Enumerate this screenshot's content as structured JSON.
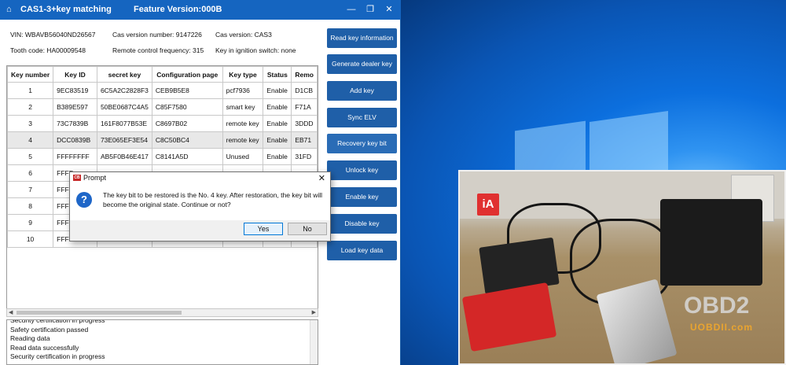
{
  "window": {
    "title": "CAS1-3+key matching",
    "feature_version": "Feature Version:000B"
  },
  "info": {
    "vin": "VIN: WBAVB56040ND26567",
    "cas_version_number": "Cas version number: 9147226",
    "cas_version": "Cas version: CAS3",
    "tooth_code": "Tooth code: HA00009548",
    "remote_control_frequency": "Remote control frequency: 315",
    "key_in_ignition": "Key in ignition switch: none"
  },
  "table": {
    "headers": [
      "Key number",
      "Key ID",
      "secret key",
      "Configuration page",
      "Key type",
      "Status",
      "Remo"
    ],
    "rows": [
      [
        "1",
        "9EC83519",
        "6C5A2C2828F3",
        "CEB9B5E8",
        "pcf7936",
        "Enable",
        "D1CB"
      ],
      [
        "2",
        "B389E597",
        "50BE0687C4A5",
        "C85F7580",
        "smart key",
        "Enable",
        "F71A"
      ],
      [
        "3",
        "73C7839B",
        "161F8077B53E",
        "C8697B02",
        "remote key",
        "Enable",
        "3DDD"
      ],
      [
        "4",
        "DCC0839B",
        "73E065EF3E54",
        "C8C50BC4",
        "remote key",
        "Enable",
        "EB71"
      ],
      [
        "5",
        "FFFFFFFF",
        "AB5F0B46E417",
        "C8141A5D",
        "Unused",
        "Enable",
        "31FD"
      ],
      [
        "6",
        "FFFF",
        "",
        "",
        "",
        "",
        ""
      ],
      [
        "7",
        "FFFF",
        "",
        "",
        "",
        "",
        ""
      ],
      [
        "8",
        "FFFF",
        "",
        "",
        "",
        "",
        ""
      ],
      [
        "9",
        "FFFF",
        "",
        "",
        "",
        "",
        ""
      ],
      [
        "10",
        "FFFF",
        "",
        "",
        "",
        "",
        ""
      ]
    ],
    "selected_row_index": 3
  },
  "log": [
    "Security certification in progress",
    "Safety certification passed",
    "Reading data",
    "Read data successfully",
    "Security certification in progress"
  ],
  "buttons": {
    "read_key_information": "Read key information",
    "generate_dealer_key": "Generate dealer key",
    "add_key": "Add key",
    "sync_elv": "Sync ELV",
    "recovery_key_bit": "Recovery key bit",
    "unlock_key": "Unlock key",
    "enable_key": "Enable key",
    "disable_key": "Disable key",
    "load_key_data": "Load key data"
  },
  "dialog": {
    "title": "Prompt",
    "app_badge": "CB",
    "message": "The key bit to be restored is the No. 4 key. After restoration, the key bit will become the original state. Continue or not?",
    "yes_label": "Yes",
    "no_label": "No"
  },
  "photo": {
    "logo_text": "iA"
  },
  "watermark": {
    "brand": "OBD2",
    "site": "UOBDII.com"
  },
  "colors": {
    "titlebar": "#1565c0",
    "button": "#1f5fa8",
    "desktop": "#0a62c7"
  }
}
